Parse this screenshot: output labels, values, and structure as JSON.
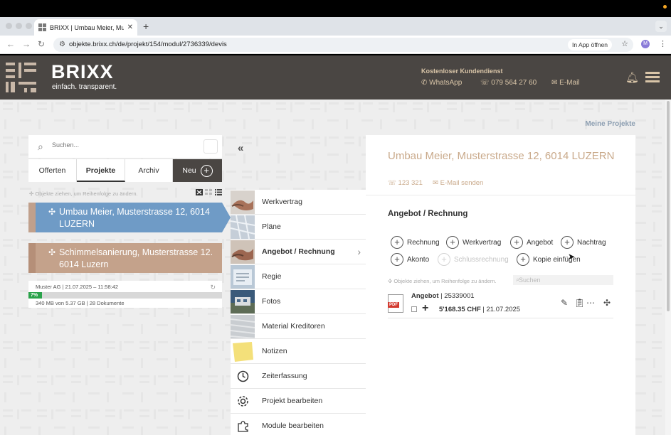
{
  "browser": {
    "tab_title": "BRIXX | Umbau Meier, Musterstrasse",
    "url": "objekte.brixx.ch/de/projekt/154/modul/2736339/devis",
    "app_button": "In App öffnen",
    "profile_initial": "M"
  },
  "header": {
    "brand": "BRIXX",
    "tagline": "einfach. transparent.",
    "support_title": "Kostenloser Kundendienst",
    "whatsapp": "WhatsApp",
    "phone": "079 564 27 60",
    "email": "E-Mail"
  },
  "page": {
    "my_projects": "Meine Projekte"
  },
  "sidebar": {
    "search_placeholder": "Suchen...",
    "tabs": [
      {
        "label": "Offerten"
      },
      {
        "label": "Projekte"
      },
      {
        "label": "Archiv"
      },
      {
        "label": "Neu"
      }
    ],
    "drag_hint": "Objekte ziehen, um Reihenfolge zu ändern.",
    "projects": [
      {
        "title": "Umbau Meier, Musterstrasse 12, 6014 LUZERN"
      },
      {
        "title": "Schimmelsanierung, Musterstrasse 12. 6014 Luzern"
      }
    ],
    "storage": {
      "info": "Muster AG | 21.07.2025 – 11:58:42",
      "percent": 7,
      "percent_label": "7%",
      "usage": "340 MB von 5.37 GB | 28 Dokumente"
    }
  },
  "modules": {
    "collapse_label": "«",
    "items": [
      {
        "label": "Werkvertrag",
        "icon": "handshake-thumbnail"
      },
      {
        "label": "Pläne",
        "icon": "plans-thumbnail"
      },
      {
        "label": "Angebot / Rechnung",
        "icon": "handshake-thumbnail"
      },
      {
        "label": "Regie",
        "icon": "regie-thumbnail"
      },
      {
        "label": "Fotos",
        "icon": "photos-thumbnail"
      },
      {
        "label": "Material Kreditoren",
        "icon": "material-thumbnail"
      },
      {
        "label": "Notizen",
        "icon": "sticky-note-thumbnail"
      },
      {
        "label": "Zeiterfassung",
        "icon": "clock-icon"
      },
      {
        "label": "Projekt bearbeiten",
        "icon": "gear-icon"
      },
      {
        "label": "Module bearbeiten",
        "icon": "puzzle-icon"
      }
    ]
  },
  "detail": {
    "title": "Umbau Meier, Musterstrasse 12, 6014 LUZERN",
    "project_number": "123 321",
    "send_email": "E-Mail senden",
    "section_title": "Angebot / Rechnung",
    "actions": [
      {
        "label": "Rechnung"
      },
      {
        "label": "Werkvertrag"
      },
      {
        "label": "Angebot"
      },
      {
        "label": "Nachtrag"
      },
      {
        "label": "Akonto"
      },
      {
        "label": "Schlussrechnung"
      },
      {
        "label": "Kopie einfügen"
      }
    ],
    "drag_hint": "Objekte ziehen, um Reihenfolge zu ändern.",
    "search_placeholder": "Suchen",
    "document": {
      "type": "Angebot",
      "number": "25339001",
      "amount": "5'168.35 CHF",
      "date": "21.07.2025",
      "file_badge": "PDF"
    }
  },
  "colors": {
    "header_bg": "#4a4643",
    "accent_gold": "#c9a98a",
    "active_project": "#6f9bc6",
    "second_project": "#c4a28b",
    "progress": "#2aa24a"
  }
}
